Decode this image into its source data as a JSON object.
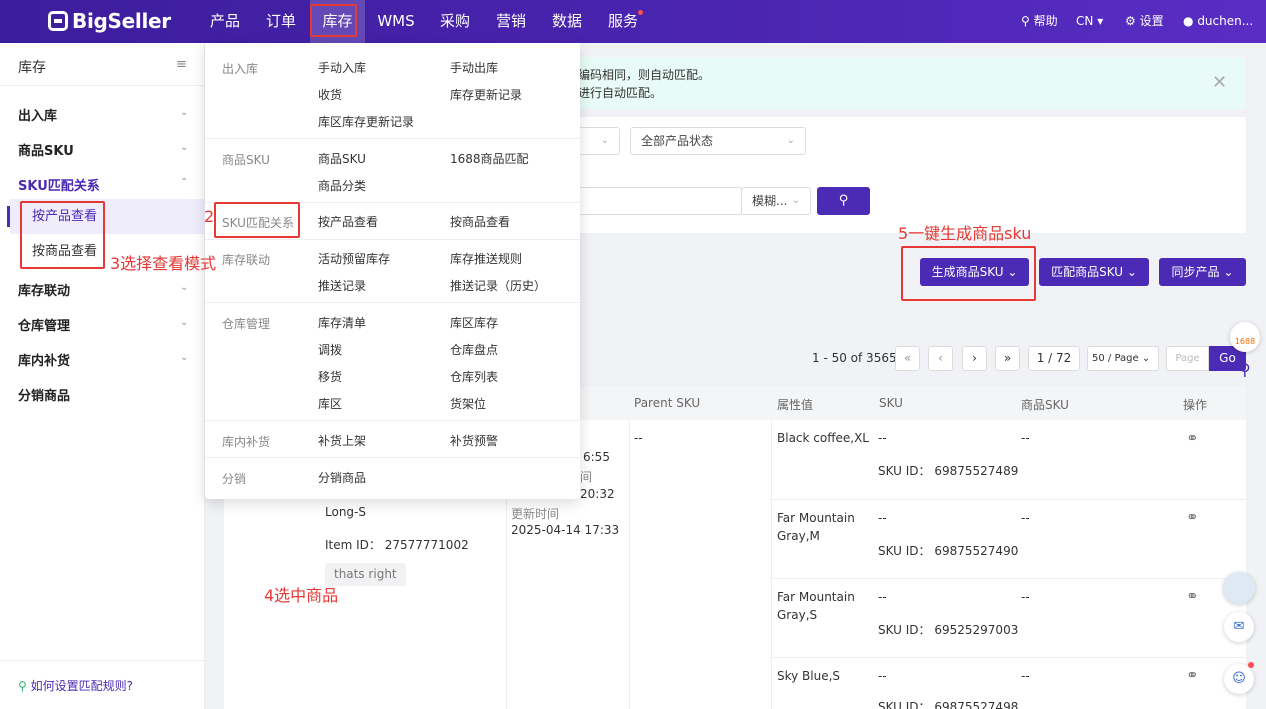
{
  "app": {
    "logo_text": "BigSeller"
  },
  "topnav": {
    "items": [
      "产品",
      "订单",
      "库存",
      "WMS",
      "采购",
      "营销",
      "数据",
      "服务"
    ],
    "help": "帮助",
    "lang": "CN",
    "settings": "设置",
    "user": "duchen..."
  },
  "sidebar": {
    "title": "库存",
    "groups": [
      "出入库",
      "商品SKU",
      "SKU匹配关系",
      "库存联动",
      "仓库管理",
      "库内补货",
      "分销商品"
    ],
    "sub_items": [
      "按产品查看",
      "按商品查看"
    ],
    "help_link": "如何设置匹配规则?"
  },
  "notice": {
    "line1": "编码相同，则自动匹配。",
    "line2": "进行自动匹配。"
  },
  "filters": {
    "status_select": "全部产品状态",
    "search_mode": "模糊..."
  },
  "toolbar": {
    "generate": "生成商品SKU",
    "match": "匹配商品SKU",
    "sync": "同步产品"
  },
  "pagination": {
    "range": "1 - 50 of 3565",
    "page": "1 / 72",
    "page_size": "50 / Page",
    "page_placeholder": "Page",
    "go": "Go"
  },
  "table": {
    "headers": [
      "Parent SKU",
      "属性值",
      "SKU",
      "商品SKU",
      "操作"
    ],
    "product": {
      "time1": "6:55",
      "time1b": "间",
      "time2": "20:32",
      "updated_label": "更新时间",
      "updated_time": "2025-04-14 17:33",
      "name_tail": "Long-S",
      "item_id": "Item ID： 27577771002",
      "tag": "thats right",
      "parent_sku": "--"
    },
    "rows": [
      {
        "attr": "Black coffee,XL",
        "attr2": "",
        "sku": "--",
        "sku_id": "SKU ID： 69875527489",
        "item_sku": "--"
      },
      {
        "attr": "Far Mountain",
        "attr2": "Gray,M",
        "sku": "--",
        "sku_id": "SKU ID： 69875527490",
        "item_sku": "--"
      },
      {
        "attr": "Far Mountain",
        "attr2": "Gray,S",
        "sku": "--",
        "sku_id": "SKU ID： 69525297003",
        "item_sku": "--"
      },
      {
        "attr": "Sky Blue,S",
        "attr2": "",
        "sku": "--",
        "sku_id": "SKU ID： 69875527498",
        "item_sku": "--"
      }
    ]
  },
  "mega_menu": {
    "sections": [
      {
        "label": "出入库",
        "items": [
          "手动入库",
          "手动出库",
          "收货",
          "库存更新记录",
          "库区库存更新记录"
        ]
      },
      {
        "label": "商品SKU",
        "items": [
          "商品SKU",
          "1688商品匹配",
          "商品分类"
        ]
      },
      {
        "label": "SKU匹配关系",
        "items": [
          "按产品查看",
          "按商品查看"
        ]
      },
      {
        "label": "库存联动",
        "items": [
          "活动预留库存",
          "库存推送规则",
          "推送记录",
          "推送记录（历史）"
        ]
      },
      {
        "label": "仓库管理",
        "items": [
          "库存清单",
          "库区库存",
          "调拨",
          "仓库盘点",
          "移货",
          "仓库列表",
          "库区",
          "货架位"
        ]
      },
      {
        "label": "库内补货",
        "items": [
          "补货上架",
          "补货预警"
        ]
      },
      {
        "label": "分销",
        "items": [
          "分销商品"
        ]
      }
    ]
  },
  "annotations": {
    "a2": "2",
    "a3": "3选择查看模式",
    "a4": "4选中商品",
    "a5": "5一键生成商品sku"
  },
  "floating": {
    "badge_1688": "1688"
  },
  "colors": {
    "brand": "#4b2bb5",
    "annotation": "#e53935",
    "notice_bg": "#e9fbf7"
  }
}
